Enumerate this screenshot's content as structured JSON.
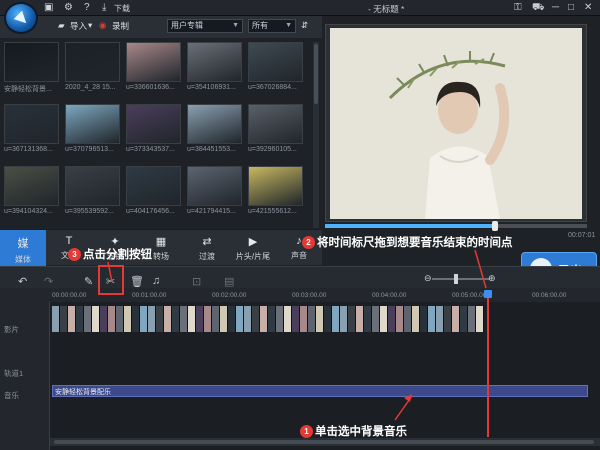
{
  "titlebar": {
    "title": "- 无标题 *",
    "download_label": "下载"
  },
  "media_toolbar": {
    "import_label": "导入",
    "record_label": "录制",
    "album_select": "用户专辑",
    "filter_select": "所有"
  },
  "media_items": [
    {
      "caption": "安静轻松背景...",
      "color": "#161a1f"
    },
    {
      "caption": "2020_4_28 15...",
      "color": "#1c2127"
    },
    {
      "caption": "u=336601636...",
      "color": "#a88888"
    },
    {
      "caption": "u=354106931...",
      "color": "#6b7078"
    },
    {
      "caption": "u=367026884...",
      "color": "#3f4a52"
    },
    {
      "caption": "u=367131368...",
      "color": "#28313a"
    },
    {
      "caption": "u=370796513...",
      "color": "#7da8bf"
    },
    {
      "caption": "u=373343537...",
      "color": "#4a3f5a"
    },
    {
      "caption": "u=384451553...",
      "color": "#8aa0b0"
    },
    {
      "caption": "u=392960105...",
      "color": "#5a6068"
    },
    {
      "caption": "u=394104324...",
      "color": "#4a4f44"
    },
    {
      "caption": "u=395539592...",
      "color": "#3a3f46"
    },
    {
      "caption": "u=404176456...",
      "color": "#2f3a44"
    },
    {
      "caption": "u=421794415...",
      "color": "#5c6470"
    },
    {
      "caption": "u=421555612...",
      "color": "#c8b860"
    }
  ],
  "func_tabs": [
    {
      "label": "媒体",
      "icon": "媒"
    },
    {
      "label": "文字",
      "icon": "T"
    },
    {
      "label": "滤镜",
      "icon": "✦"
    },
    {
      "label": "转场",
      "icon": "▦"
    },
    {
      "label": "过渡",
      "icon": "⇄"
    },
    {
      "label": "片头/片尾",
      "icon": "▶"
    },
    {
      "label": "声音",
      "icon": "♪"
    }
  ],
  "preview": {
    "time_display": "00:07:01",
    "progress": 0.65
  },
  "export_label": "导出",
  "ruler_ticks": [
    "00:00:00.00",
    "00:01:00.00",
    "00:02:00.00",
    "00:03:00.00",
    "00:04:00.00",
    "00:05:00.00",
    "00:06:00.00"
  ],
  "tracks": {
    "video_label": "影片",
    "overlay_label": "轨道1",
    "music_label": "音乐",
    "music_clip": "安静轻松背景配乐"
  },
  "annotations": {
    "step1": "单击选中背景音乐",
    "step2": "将时间标尺拖到想要音乐结束的时间点",
    "step3": "点击分割按钮"
  },
  "colors": {
    "accent": "#2e7bd6",
    "marker": "#e53935"
  }
}
